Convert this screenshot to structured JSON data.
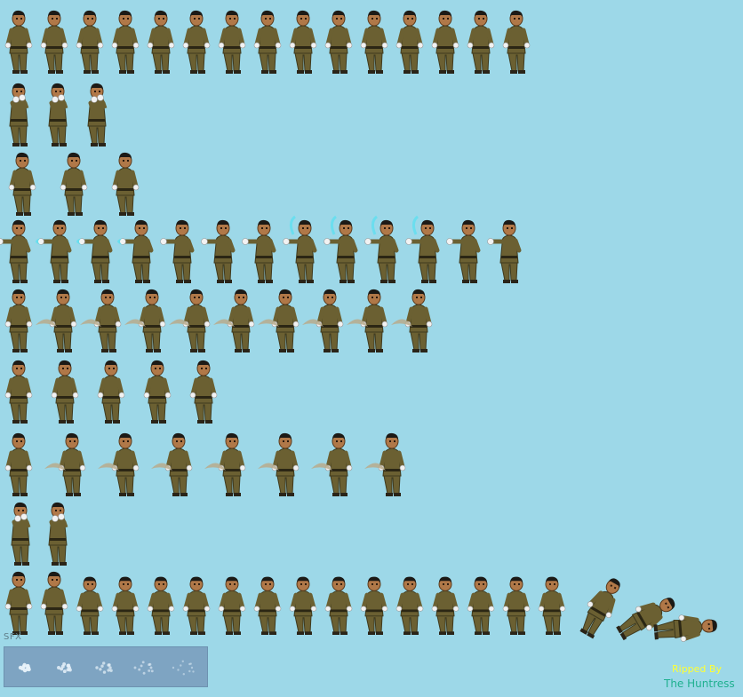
{
  "sheet": {
    "background": "#9dd8e8",
    "uniform_color": "#6b6032",
    "skin_color": "#b07848",
    "hair_color": "#1c1a16",
    "glove_color": "#f2f2f2",
    "punch_effect_color": "#5fe0f0",
    "kick_trail_color": "#b8ab8c",
    "rows": [
      {
        "name": "idle",
        "frames": 15
      },
      {
        "name": "guard",
        "frames": 3
      },
      {
        "name": "walk",
        "frames": 3
      },
      {
        "name": "punch-combo",
        "frames": 13
      },
      {
        "name": "spin-kick",
        "frames": 10
      },
      {
        "name": "turn",
        "frames": 5
      },
      {
        "name": "sweep-kick",
        "frames": 8
      },
      {
        "name": "block",
        "frames": 2
      },
      {
        "name": "defeat",
        "frames": 19
      }
    ]
  },
  "sfx": {
    "label": "SFX",
    "frames": 5,
    "strip_color": "#7ea4c2"
  },
  "credits": {
    "ripped_by": "Ripped By",
    "author": "The Huntress"
  }
}
